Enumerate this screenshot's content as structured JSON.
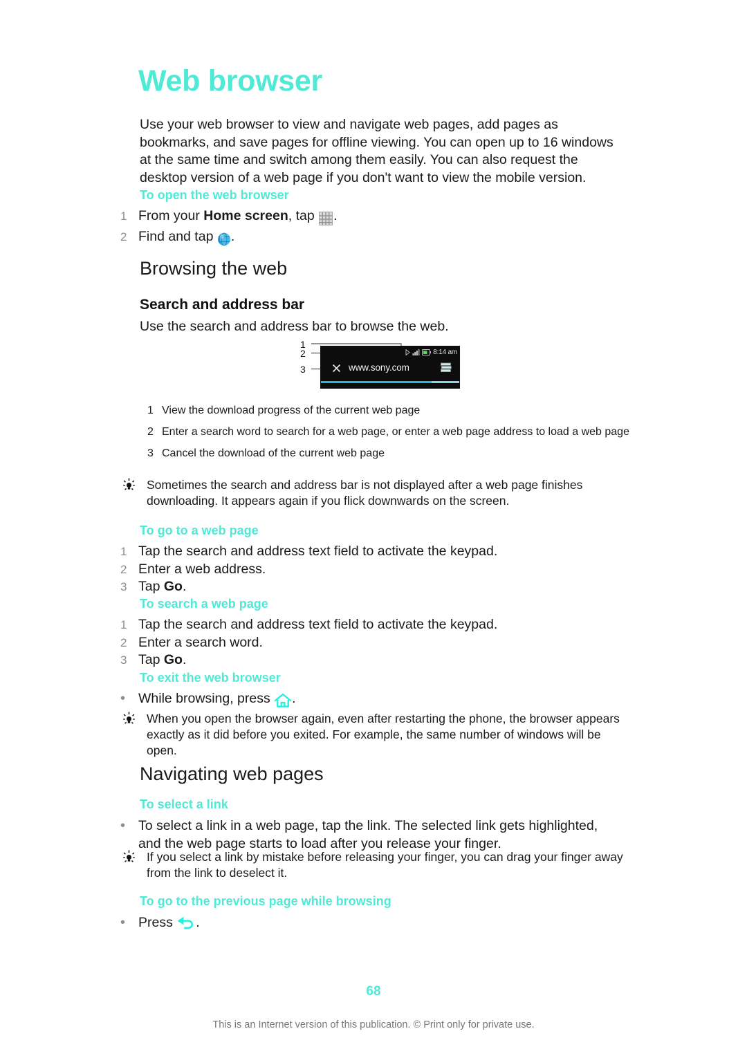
{
  "document": {
    "title": "Web browser",
    "intro": "Use your web browser to view and navigate web pages, add pages as bookmarks, and save pages for offline viewing. You can open up to 16 windows at the same time and switch among them easily. You can also request the desktop version of a web page if you don't want to view the mobile version.",
    "page_number": "68",
    "footnote": "This is an Internet version of this publication. © Print only for private use."
  },
  "colors": {
    "accent": "#4fead6",
    "text": "#1a1a1a",
    "muted_number": "#8c8c8c",
    "footnote": "#777777",
    "progress": "#27b7d1"
  },
  "sections": {
    "open_browser": {
      "heading": "To open the web browser",
      "steps": [
        {
          "num": "1",
          "pre": "From your ",
          "bold": "Home screen",
          "post": ", tap ",
          "icon": "app-grid-icon",
          "end": "."
        },
        {
          "num": "2",
          "pre": "Find and tap ",
          "bold": "",
          "post": "",
          "icon": "globe-icon",
          "end": "."
        }
      ]
    },
    "browsing_the_web": {
      "heading": "Browsing the web",
      "subheading": "Search and address bar",
      "body": "Use the search and address bar to browse the web."
    },
    "figure": {
      "callout_numbers": [
        "1",
        "2",
        "3"
      ],
      "phone": {
        "status_time": "8:14 am",
        "address_value": "www.sony.com",
        "cancel_icon": "cancel-x-icon",
        "windows_icon": "browser-windows-icon",
        "signal_icon": "signal-bars-icon",
        "battery_icon": "battery-icon",
        "progress_percent": 80
      },
      "captions": [
        {
          "n": "1",
          "text": "View the download progress of the current web page"
        },
        {
          "n": "2",
          "text": "Enter a search word to search for a web page, or enter a web page address to load a web page"
        },
        {
          "n": "3",
          "text": "Cancel the download of the current web page"
        }
      ]
    },
    "tip_search_bar": {
      "text": "Sometimes the search and address bar is not displayed after a web page finishes downloading. It appears again if you flick downwards on the screen."
    },
    "go_to_web_page": {
      "heading": "To go to a web page",
      "steps": [
        {
          "num": "1",
          "pre": "Tap the search and address text field to activate the keypad.",
          "bold": "",
          "post": ""
        },
        {
          "num": "2",
          "pre": "Enter a web address.",
          "bold": "",
          "post": ""
        },
        {
          "num": "3",
          "pre": "Tap ",
          "bold": "Go",
          "post": "."
        }
      ]
    },
    "search_web_page": {
      "heading": "To search a web page",
      "steps": [
        {
          "num": "1",
          "pre": "Tap the search and address text field to activate the keypad.",
          "bold": "",
          "post": ""
        },
        {
          "num": "2",
          "pre": "Enter a search word.",
          "bold": "",
          "post": ""
        },
        {
          "num": "3",
          "pre": "Tap ",
          "bold": "Go",
          "post": "."
        }
      ]
    },
    "exit_browser": {
      "heading": "To exit the web browser",
      "bullet_pre": "While browsing, press ",
      "bullet_icon": "home-icon",
      "bullet_end": "."
    },
    "tip_reopen": {
      "text": "When you open the browser again, even after restarting the phone, the browser appears exactly as it did before you exited. For example, the same number of windows will be open."
    },
    "navigating": {
      "heading": "Navigating web pages",
      "select_link": {
        "heading": "To select a link",
        "bullet": "To select a link in a web page, tap the link. The selected link gets highlighted, and the web page starts to load after you release your finger."
      },
      "tip_deselect": {
        "text": "If you select a link by mistake before releasing your finger, you can drag your finger away from the link to deselect it."
      },
      "previous_page": {
        "heading": "To go to the previous page while browsing",
        "bullet_pre": "Press ",
        "bullet_icon": "back-arrow-icon",
        "bullet_end": "."
      }
    }
  }
}
